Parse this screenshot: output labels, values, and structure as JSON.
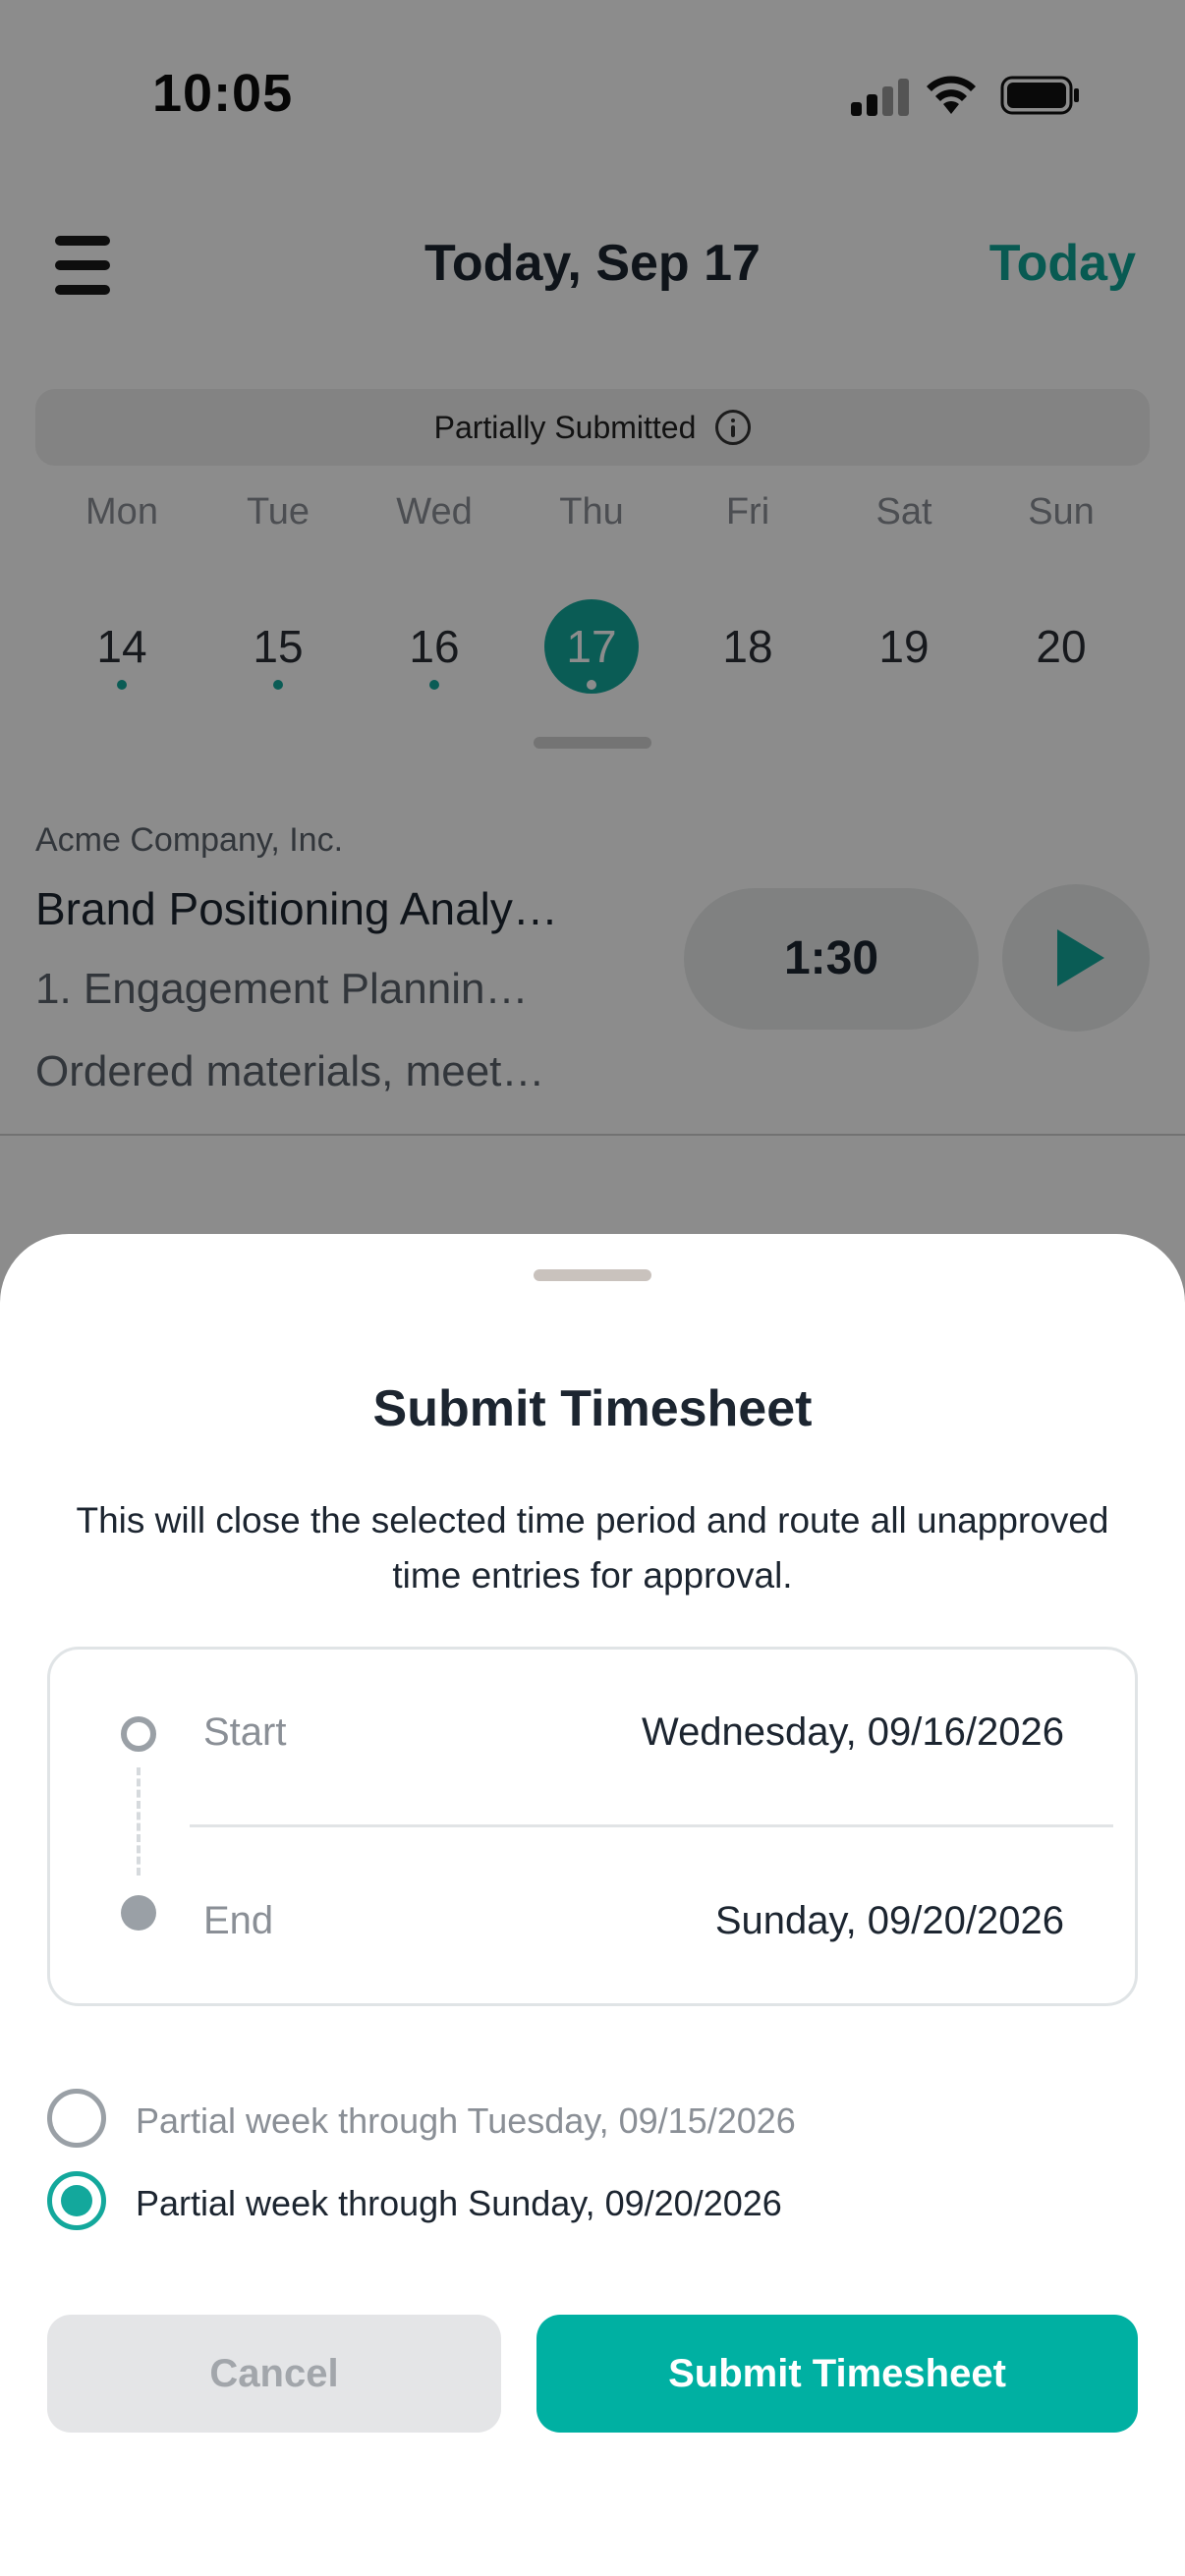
{
  "status_bar": {
    "time": "10:05"
  },
  "header": {
    "title": "Today, Sep 17",
    "today_label": "Today"
  },
  "submission_status": {
    "label": "Partially Submitted",
    "icon": "info-icon"
  },
  "week": {
    "day_labels": [
      "Mon",
      "Tue",
      "Wed",
      "Thu",
      "Fri",
      "Sat",
      "Sun"
    ],
    "dates": [
      "14",
      "15",
      "16",
      "17",
      "18",
      "19",
      "20"
    ],
    "selected_index": 3,
    "has_entries": [
      true,
      true,
      true,
      true,
      false,
      false,
      false
    ]
  },
  "time_entry": {
    "client": "Acme Company, Inc.",
    "project": "Brand Positioning Analy…",
    "task": "1. Engagement Plannin…",
    "notes": "Ordered materials, meet…",
    "duration": "1:30"
  },
  "sheet": {
    "title": "Submit Timesheet",
    "description": "This will close the selected time period and route all unapproved time entries for approval.",
    "range": {
      "start_label": "Start",
      "start_value": "Wednesday, 09/16/2026",
      "end_label": "End",
      "end_value": "Sunday, 09/20/2026"
    },
    "options": [
      {
        "label": "Partial week through Tuesday, 09/15/2026",
        "selected": false
      },
      {
        "label": "Partial week through Sunday, 09/20/2026",
        "selected": true
      }
    ],
    "cancel_label": "Cancel",
    "submit_label": "Submit Timesheet"
  },
  "colors": {
    "accent": "#13a89c",
    "submit_button": "#00b0a2",
    "text_primary": "#1c2530",
    "text_muted": "#8a8f96"
  }
}
